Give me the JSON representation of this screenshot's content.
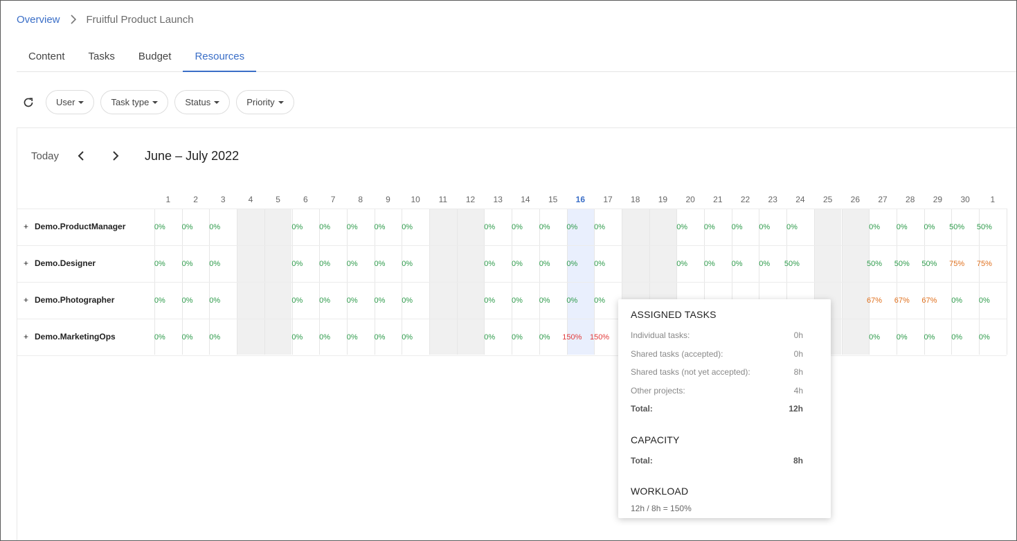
{
  "breadcrumb": {
    "root": "Overview",
    "current": "Fruitful Product Launch"
  },
  "tabs": [
    {
      "label": "Content"
    },
    {
      "label": "Tasks"
    },
    {
      "label": "Budget"
    },
    {
      "label": "Resources",
      "active": true
    }
  ],
  "filters": [
    "User",
    "Task type",
    "Status",
    "Priority"
  ],
  "calendar": {
    "today_label": "Today",
    "range": "June – July 2022",
    "days": [
      "1",
      "2",
      "3",
      "4",
      "5",
      "6",
      "7",
      "8",
      "9",
      "10",
      "11",
      "12",
      "13",
      "14",
      "15",
      "16",
      "17",
      "18",
      "19",
      "20",
      "21",
      "22",
      "23",
      "24",
      "25",
      "26",
      "27",
      "28",
      "29",
      "30",
      "1"
    ],
    "today_index": 15,
    "weekend_indices": [
      3,
      4,
      10,
      11,
      17,
      18,
      24,
      25
    ],
    "rows": [
      {
        "name": "Demo.ProductManager",
        "cells": [
          "0%",
          "0%",
          "0%",
          "",
          "",
          "0%",
          "0%",
          "0%",
          "0%",
          "0%",
          "",
          "",
          "0%",
          "0%",
          "0%",
          "0%",
          "0%",
          "",
          "",
          "0%",
          "0%",
          "0%",
          "0%",
          "0%",
          "",
          "",
          "0%",
          "0%",
          "0%",
          "50%",
          "50%"
        ],
        "colors": [
          "g",
          "g",
          "g",
          "",
          "",
          "g",
          "g",
          "g",
          "g",
          "g",
          "",
          "",
          "g",
          "g",
          "g",
          "g",
          "g",
          "",
          "",
          "g",
          "g",
          "g",
          "g",
          "g",
          "",
          "",
          "g",
          "g",
          "g",
          "g",
          "g"
        ]
      },
      {
        "name": "Demo.Designer",
        "cells": [
          "0%",
          "0%",
          "0%",
          "",
          "",
          "0%",
          "0%",
          "0%",
          "0%",
          "0%",
          "",
          "",
          "0%",
          "0%",
          "0%",
          "0%",
          "0%",
          "",
          "",
          "0%",
          "0%",
          "0%",
          "0%",
          "50%",
          "",
          "",
          "50%",
          "50%",
          "50%",
          "75%",
          "75%"
        ],
        "colors": [
          "g",
          "g",
          "g",
          "",
          "",
          "g",
          "g",
          "g",
          "g",
          "g",
          "",
          "",
          "g",
          "g",
          "g",
          "g",
          "g",
          "",
          "",
          "g",
          "g",
          "g",
          "g",
          "g",
          "",
          "",
          "g",
          "g",
          "g",
          "o",
          "o"
        ]
      },
      {
        "name": "Demo.Photographer",
        "cells": [
          "0%",
          "0%",
          "0%",
          "",
          "",
          "0%",
          "0%",
          "0%",
          "0%",
          "0%",
          "",
          "",
          "0%",
          "0%",
          "0%",
          "0%",
          "0%",
          "",
          "",
          "",
          "",
          "",
          "",
          "",
          "",
          "",
          "67%",
          "67%",
          "67%",
          "0%",
          "0%"
        ],
        "colors": [
          "g",
          "g",
          "g",
          "",
          "",
          "g",
          "g",
          "g",
          "g",
          "g",
          "",
          "",
          "g",
          "g",
          "g",
          "g",
          "g",
          "",
          "",
          "",
          "",
          "",
          "",
          "",
          "",
          "",
          "o",
          "o",
          "o",
          "g",
          "g"
        ]
      },
      {
        "name": "Demo.MarketingOps",
        "cells": [
          "0%",
          "0%",
          "0%",
          "",
          "",
          "0%",
          "0%",
          "0%",
          "0%",
          "0%",
          "",
          "",
          "0%",
          "0%",
          "0%",
          "150%",
          "150%",
          "",
          "",
          "",
          "",
          "",
          "",
          "",
          "",
          "",
          "0%",
          "0%",
          "0%",
          "0%",
          "0%"
        ],
        "colors": [
          "g",
          "g",
          "g",
          "",
          "",
          "g",
          "g",
          "g",
          "g",
          "g",
          "",
          "",
          "g",
          "g",
          "g",
          "r",
          "r",
          "",
          "",
          "",
          "",
          "",
          "",
          "",
          "",
          "",
          "g",
          "g",
          "g",
          "g",
          "g"
        ]
      }
    ]
  },
  "tooltip": {
    "assigned_title": "ASSIGNED TASKS",
    "assigned": [
      {
        "label": "Individual tasks:",
        "value": "0h"
      },
      {
        "label": "Shared tasks (accepted):",
        "value": "0h"
      },
      {
        "label": "Shared tasks (not yet accepted):",
        "value": "8h"
      },
      {
        "label": "Other projects:",
        "value": "4h"
      }
    ],
    "assigned_total_label": "Total:",
    "assigned_total": "12h",
    "capacity_title": "CAPACITY",
    "capacity_total_label": "Total:",
    "capacity_total": "8h",
    "workload_title": "WORKLOAD",
    "workload_formula": "12h / 8h = 150%"
  },
  "colors": {
    "accent": "#3a6ec7",
    "ok": "#2e9b4b",
    "warn": "#e0701d",
    "over": "#e23a3a"
  }
}
